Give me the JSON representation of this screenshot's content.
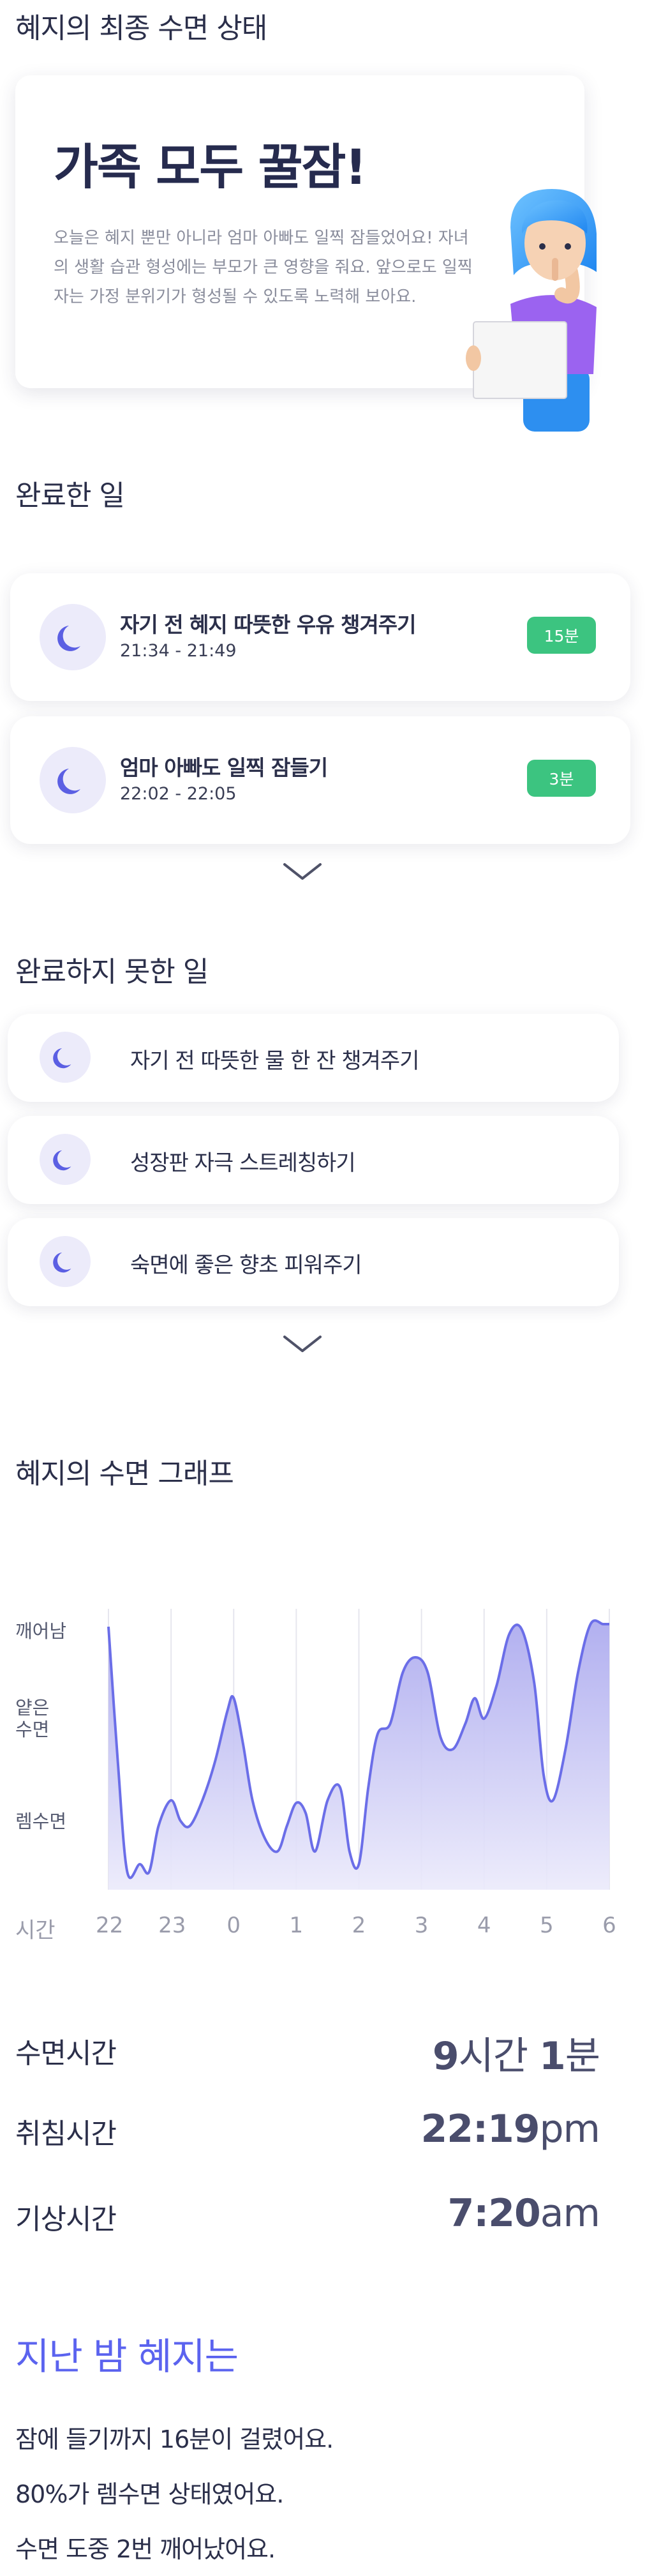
{
  "header": {
    "title": "혜지의 최종 수면 상태"
  },
  "hero": {
    "headline": "가족 모두 꿀잠!",
    "body": "오늘은 혜지 뿐만 아니라 엄마 아빠도 일찍 잠들었어요! 자녀의 생활 습관 형성에는 부모가 큰 영향을 줘요. 앞으로도 일찍 자는 가정 분위기가 형성될 수 있도록 노력해 보아요."
  },
  "completed": {
    "title": "완료한 일",
    "items": [
      {
        "title": "자기 전 혜지 따뜻한 우유 챙겨주기",
        "time": "21:34 - 21:49",
        "badge": "15분"
      },
      {
        "title": "엄마 아빠도 일찍 잠들기",
        "time": "22:02 - 22:05",
        "badge": "3분"
      }
    ]
  },
  "incomplete": {
    "title": "완료하지 못한 일",
    "items": [
      {
        "label": "자기 전 따뜻한 물 한 잔 챙겨주기"
      },
      {
        "label": "성장판 자극 스트레칭하기"
      },
      {
        "label": "숙면에 좋은 향초 피워주기"
      }
    ]
  },
  "graph": {
    "title": "혜지의 수면 그래프"
  },
  "chart_data": {
    "type": "area",
    "y_categories": [
      "렘수면",
      "얕은 수면",
      "깨어남"
    ],
    "y_labels": {
      "awake": "깨어남",
      "light_line1": "얕은",
      "light_line2": "수면",
      "rem": "렘수면"
    },
    "x_axis_label": "시간",
    "x_ticks": [
      "22",
      "23",
      "0",
      "1",
      "2",
      "3",
      "4",
      "5",
      "6"
    ],
    "x": [
      22.0,
      22.15,
      22.3,
      22.5,
      22.65,
      22.8,
      23.0,
      23.15,
      23.3,
      23.5,
      23.7,
      23.9,
      24.0,
      24.15,
      24.3,
      24.5,
      24.7,
      24.85,
      25.0,
      25.15,
      25.3,
      25.5,
      25.7,
      25.85,
      26.0,
      26.15,
      26.3,
      26.5,
      26.7,
      26.9,
      27.1,
      27.3,
      27.5,
      27.7,
      27.85,
      28.0,
      28.2,
      28.4,
      28.6,
      28.8,
      28.95,
      29.1,
      29.3,
      29.5,
      29.7,
      29.9,
      30.0
    ],
    "y": [
      0.98,
      0.45,
      0.02,
      0.05,
      0.02,
      0.2,
      0.3,
      0.22,
      0.2,
      0.3,
      0.45,
      0.65,
      0.7,
      0.52,
      0.3,
      0.15,
      0.1,
      0.2,
      0.29,
      0.25,
      0.1,
      0.3,
      0.35,
      0.1,
      0.05,
      0.35,
      0.56,
      0.6,
      0.8,
      0.86,
      0.8,
      0.55,
      0.5,
      0.6,
      0.7,
      0.62,
      0.75,
      0.95,
      0.97,
      0.76,
      0.4,
      0.3,
      0.5,
      0.8,
      0.99,
      0.99,
      0.99
    ],
    "xlim": [
      22,
      30
    ],
    "colors": {
      "line": "#6b6ee8",
      "fill_top": "#a9a7ee",
      "fill_bottom": "#ebeafb"
    }
  },
  "stats": {
    "sleep_time": {
      "label": "수면시간",
      "n1": "9",
      "u1": "시간 ",
      "n2": "1",
      "u2": "분"
    },
    "bed_time": {
      "label": "취침시간",
      "num": "22:19",
      "unit": "pm"
    },
    "wake_time": {
      "label": "기상시간",
      "num": "7:20",
      "unit": "am"
    }
  },
  "summary": {
    "title": "지난 밤 혜지는",
    "lines": [
      "잠에 들기까지 16분이 걸렸어요.",
      "80%가 렘수면 상태였어요.",
      "수면 도중 2번 깨어났어요."
    ]
  },
  "icons": {
    "moon": "moon-icon",
    "chevron": "chevron-down-icon"
  },
  "colors": {
    "accent": "#5b63ef",
    "badge": "#3cc480",
    "moon": "#5b5fe3",
    "moon_bg": "#ecebfa"
  }
}
